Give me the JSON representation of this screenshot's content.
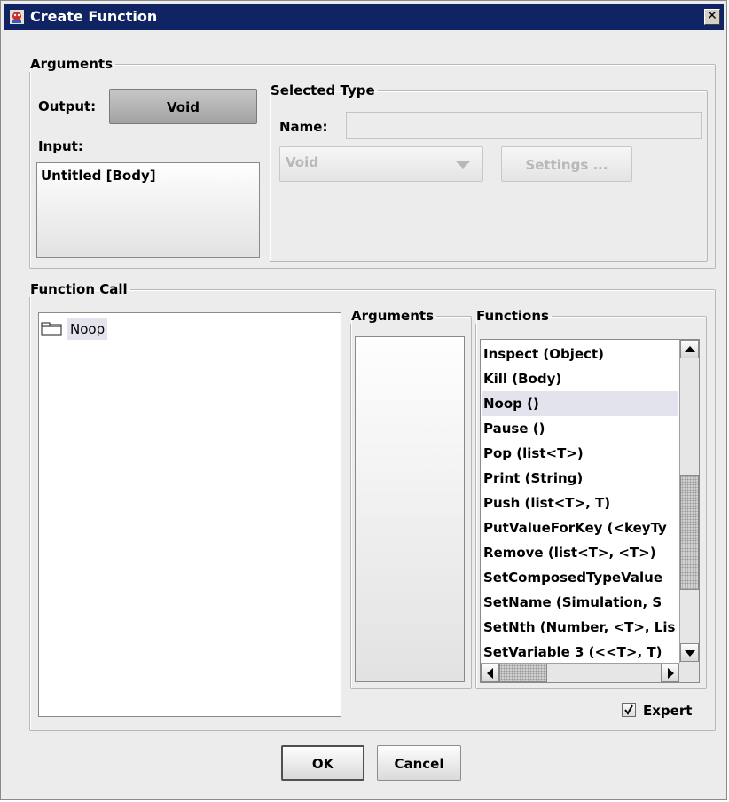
{
  "window": {
    "title": "Create Function",
    "close_glyph": "✕"
  },
  "arguments_group": {
    "legend": "Arguments",
    "output_label": "Output:",
    "output_value": "Void",
    "input_label": "Input:",
    "input_items": [
      "Untitled [Body]"
    ]
  },
  "selected_type": {
    "legend": "Selected Type",
    "name_label": "Name:",
    "name_value": "",
    "type_value": "Void",
    "settings_label": "Settings ..."
  },
  "function_call": {
    "legend": "Function Call",
    "tree_items": [
      "Noop"
    ],
    "arguments_legend": "Arguments",
    "functions_legend": "Functions",
    "functions": [
      "Inspect  (Object)",
      "Kill  (Body)",
      "Noop  ()",
      "Pause  ()",
      "Pop (list<T>)",
      "Print  (String)",
      "Push (list<T>, T)",
      "PutValueForKey (<keyTy",
      "Remove (list<T>, <T>)",
      "SetComposedTypeValue",
      "SetName  (Simulation, S",
      "SetNth (Number, <T>, Lis",
      "SetVariable 3 (<<T>, T)"
    ],
    "selected_function": "Noop  ()",
    "expert_label": "Expert",
    "expert_checked": true
  },
  "buttons": {
    "ok": "OK",
    "cancel": "Cancel"
  }
}
